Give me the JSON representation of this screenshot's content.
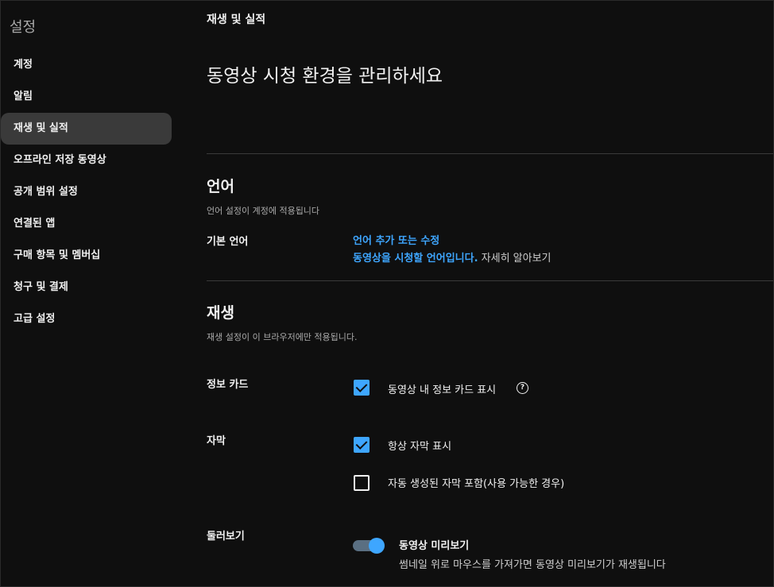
{
  "sidebar": {
    "title": "설정",
    "items": [
      {
        "label": "계정"
      },
      {
        "label": "알림"
      },
      {
        "label": "재생 및 실적",
        "active": true
      },
      {
        "label": "오프라인 저장 동영상"
      },
      {
        "label": "공개 범위 설정"
      },
      {
        "label": "연결된 앱"
      },
      {
        "label": "구매 항목 및 멤버십"
      },
      {
        "label": "청구 및 결제"
      },
      {
        "label": "고급 설정"
      }
    ]
  },
  "main": {
    "breadcrumb": "재생 및 실적",
    "headline": "동영상 시청 환경을 관리하세요",
    "language": {
      "title": "언어",
      "description": "언어 설정이 계정에 적용됩니다",
      "row_label": "기본 언어",
      "link": "언어 추가 또는 수정",
      "info_link": "동영상을 시청할 언어입니다.",
      "info_more": " 자세히 알아보기"
    },
    "playback": {
      "title": "재생",
      "description": "재생 설정이 이 브라우저에만 적용됩니다.",
      "info_cards": {
        "label": "정보 카드",
        "option": "동영상 내 정보 카드 표시",
        "checked": true,
        "help_icon": "question-circle-icon"
      },
      "captions": {
        "label": "자막",
        "options": [
          {
            "text": "항상 자막 표시",
            "checked": true
          },
          {
            "text": "자동 생성된 자막 포함(사용 가능한 경우)",
            "checked": false
          }
        ]
      },
      "browse": {
        "label": "둘러보기",
        "toggle_title": "동영상 미리보기",
        "toggle_desc": "썸네일 위로 마우스를 가져가면 동영상 미리보기가 재생됩니다",
        "enabled": true
      }
    }
  },
  "colors": {
    "background": "#0f0f0f",
    "accent": "#3ea6ff",
    "active_nav": "#3a3a3a"
  }
}
